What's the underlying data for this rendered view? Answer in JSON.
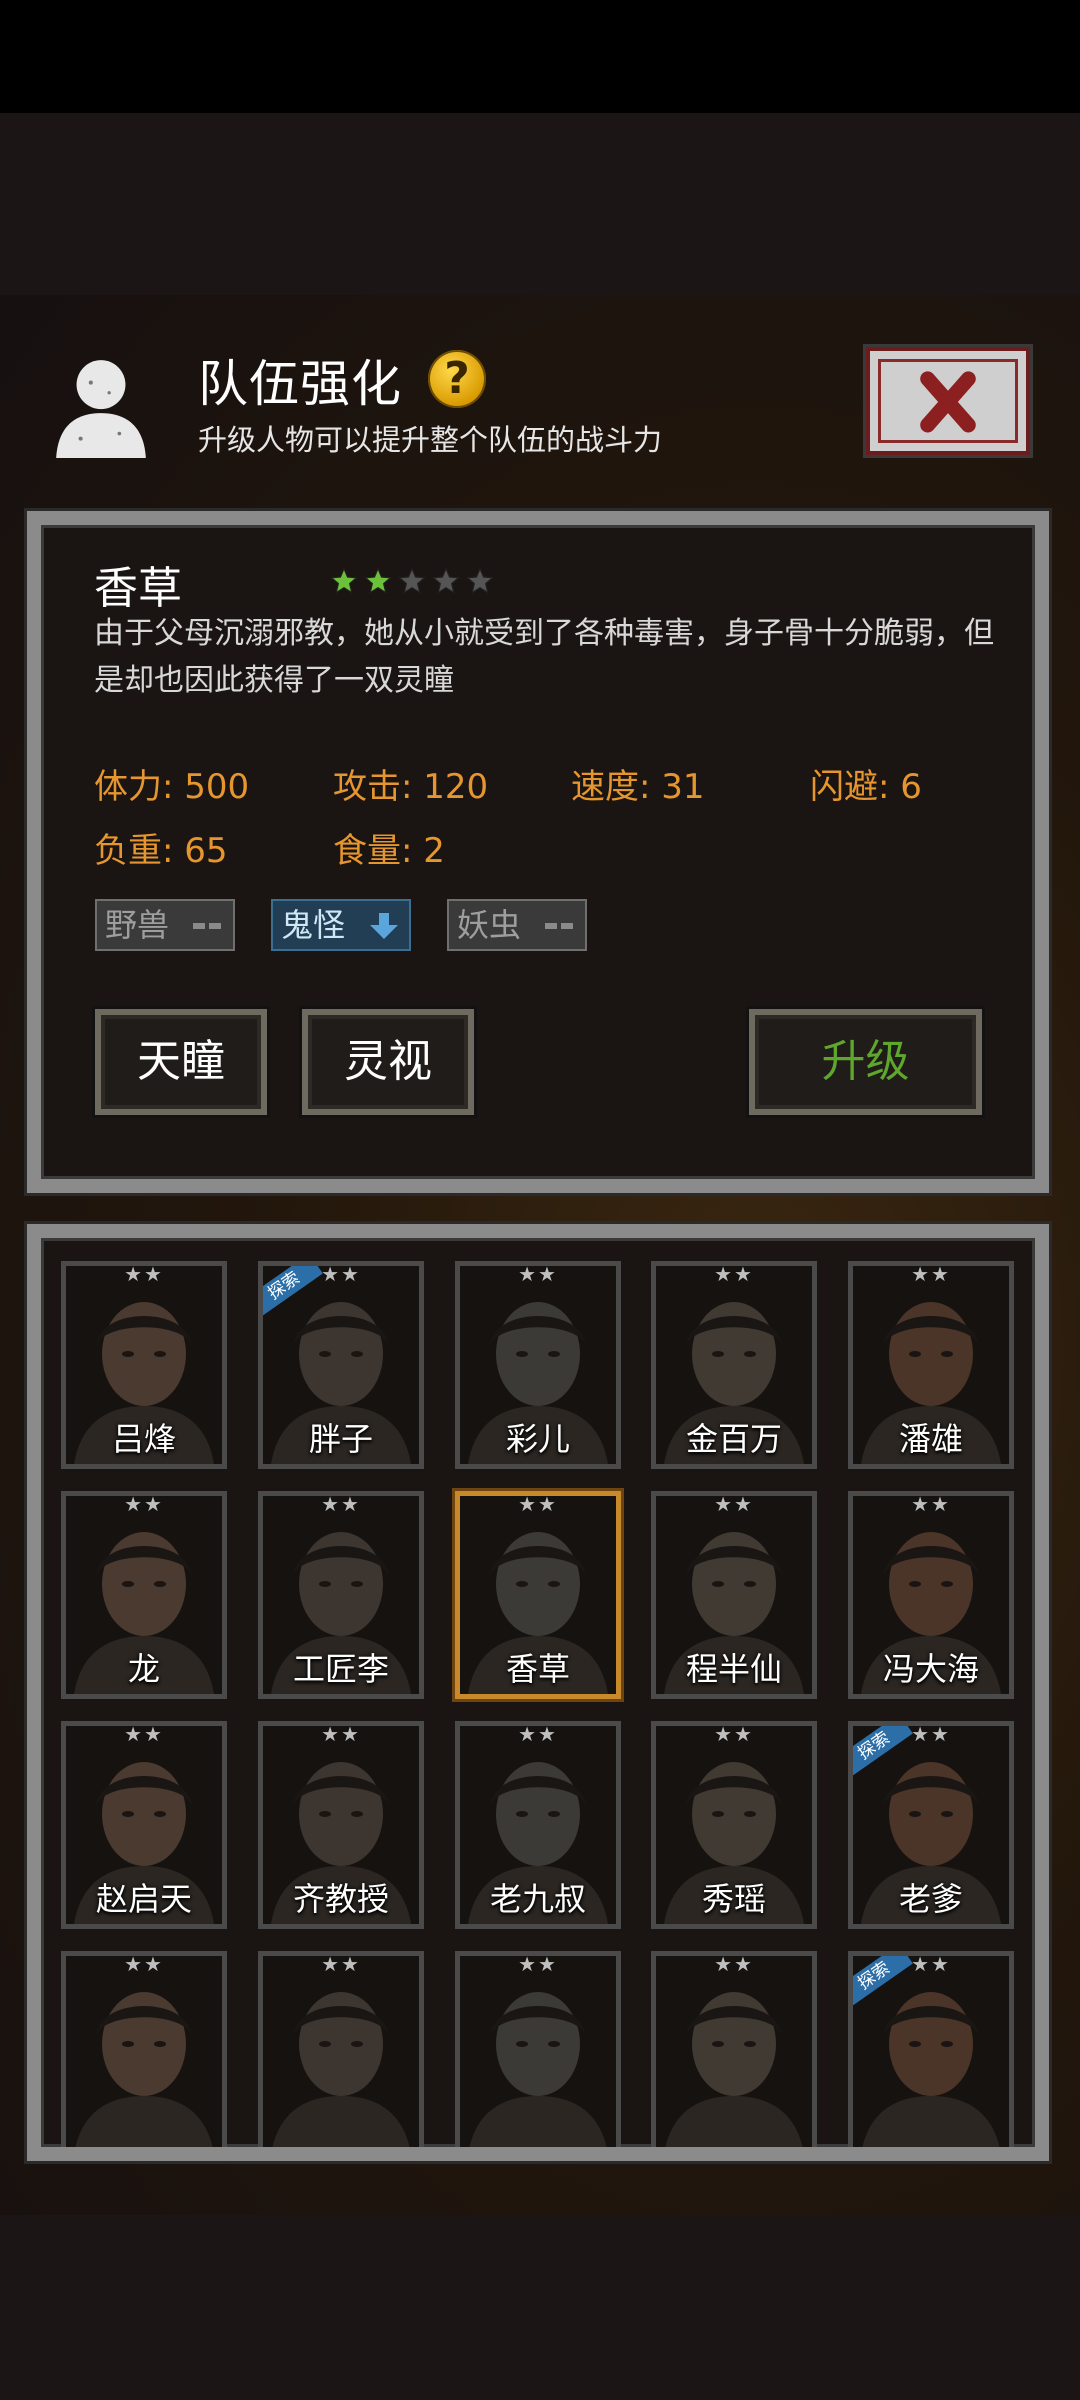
{
  "header": {
    "title": "队伍强化",
    "help_icon": "?",
    "subtitle": "升级人物可以提升整个队伍的战斗力"
  },
  "character": {
    "name": "香草",
    "stars_filled": 2,
    "stars_total": 5,
    "description": "由于父母沉溺邪教，她从小就受到了各种毒害，身子骨十分脆弱，但是却也因此获得了一双灵瞳",
    "stats": {
      "hp": "体力: 500",
      "attack": "攻击: 120",
      "speed": "速度: 31",
      "dodge": "闪避: 6",
      "load": "负重: 65",
      "food": "食量: 2"
    },
    "affinities": [
      {
        "label": "野兽",
        "state": "neutral"
      },
      {
        "label": "鬼怪",
        "state": "down"
      },
      {
        "label": "妖虫",
        "state": "neutral"
      }
    ],
    "skills": [
      "天瞳",
      "灵视"
    ],
    "upgrade_label": "升级"
  },
  "roster": [
    {
      "name": "吕烽",
      "badge": ""
    },
    {
      "name": "胖子",
      "badge": "探索"
    },
    {
      "name": "彩儿",
      "badge": ""
    },
    {
      "name": "金百万",
      "badge": ""
    },
    {
      "name": "潘雄",
      "badge": ""
    },
    {
      "name": "龙",
      "badge": ""
    },
    {
      "name": "工匠李",
      "badge": ""
    },
    {
      "name": "香草",
      "badge": ""
    },
    {
      "name": "程半仙",
      "badge": ""
    },
    {
      "name": "冯大海",
      "badge": ""
    },
    {
      "name": "赵启天",
      "badge": ""
    },
    {
      "name": "齐教授",
      "badge": ""
    },
    {
      "name": "老九叔",
      "badge": ""
    },
    {
      "name": "秀瑶",
      "badge": ""
    },
    {
      "name": "老爹",
      "badge": "探索"
    },
    {
      "name": "",
      "badge": ""
    },
    {
      "name": "",
      "badge": ""
    },
    {
      "name": "",
      "badge": ""
    },
    {
      "name": "",
      "badge": ""
    },
    {
      "name": "",
      "badge": "探索"
    }
  ],
  "roster_stars": "★★",
  "selected_index": 7,
  "colors": {
    "stat_orange": "#e6962e",
    "upgrade_green": "#5fa72c",
    "star_green": "#6cc13a",
    "selected_gold": "#c7892a",
    "badge_blue": "#2c6fa8"
  }
}
